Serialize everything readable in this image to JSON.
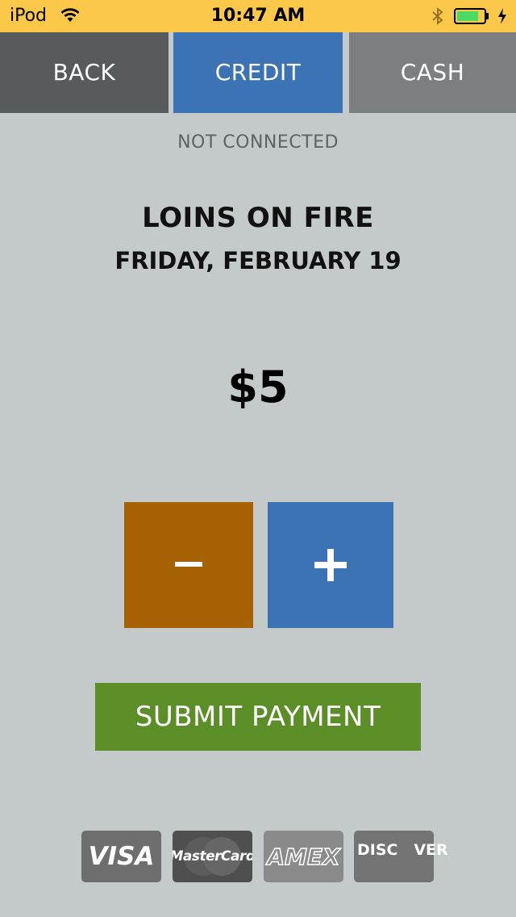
{
  "status": {
    "carrier": "iPod",
    "time": "10:47 AM",
    "battery_color": "#4cd964"
  },
  "tabs": {
    "back": "BACK",
    "credit": "CREDIT",
    "cash": "CASH"
  },
  "connection_status": "NOT CONNECTED",
  "event": {
    "name": "LOINS ON FIRE",
    "date": "FRIDAY, FEBRUARY 19"
  },
  "amount": "$5",
  "quantity_buttons": {
    "decrement": "–",
    "increment": "+"
  },
  "submit_label": "SUBMIT PAYMENT",
  "cards": {
    "visa": "VISA",
    "mastercard": "MasterCard",
    "amex": "AMEX",
    "discover": "DISC   VER"
  },
  "colors": {
    "background": "#c4c9ca",
    "status_bar": "#fcc84a",
    "back_tab": "#575b5c",
    "credit_tab": "#3c73b4",
    "cash_tab": "#7c7e7f",
    "minus": "#a86206",
    "plus": "#3c73b4",
    "submit": "#5b8e27"
  }
}
